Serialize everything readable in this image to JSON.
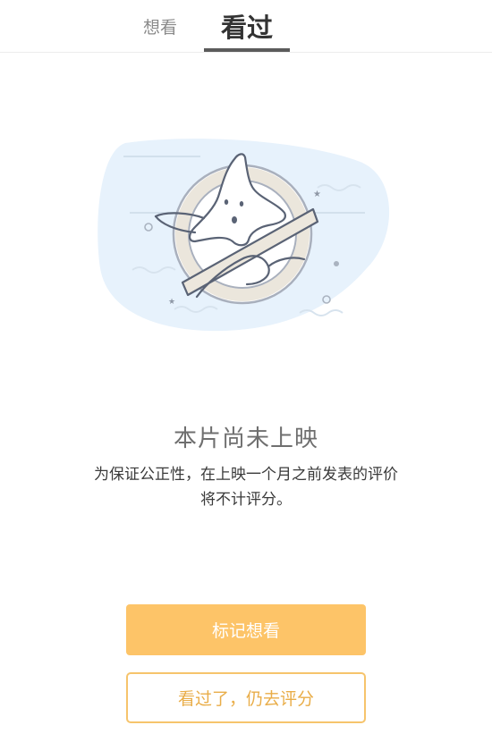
{
  "tabs": {
    "want": "想看",
    "seen": "看过"
  },
  "notice": {
    "title": "本片尚未上映",
    "description_line1": "为保证公正性，在上映一个月之前发表的评价",
    "description_line2": "将不计评分。"
  },
  "buttons": {
    "mark_want": "标记想看",
    "rate_anyway": "看过了，仍去评分"
  },
  "colors": {
    "accent": "#fdc468",
    "accent_border": "#f6c46c",
    "accent_text": "#e9ad48",
    "illustration_bg": "#e7f2fc"
  },
  "icons": {
    "illustration": "no-star-ghost-illustration"
  }
}
